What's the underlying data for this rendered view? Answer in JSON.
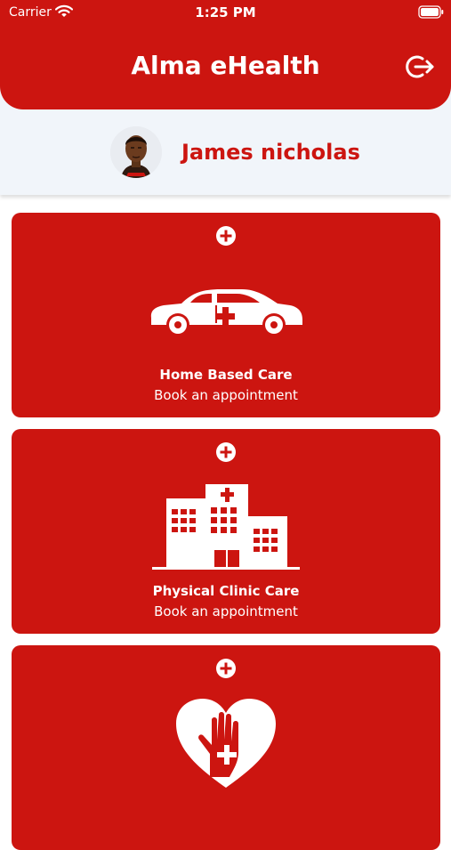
{
  "status_bar": {
    "carrier": "Carrier",
    "time": "1:25 PM"
  },
  "header": {
    "title": "Alma eHealth",
    "logout_icon": "logout-icon"
  },
  "profile": {
    "name": "James nicholas",
    "avatar": "avatar"
  },
  "services": [
    {
      "title": "Home Based Care",
      "subtitle": "Book an appointment",
      "icon": "ambulance-car-icon"
    },
    {
      "title": "Physical Clinic Care",
      "subtitle": "Book an appointment",
      "icon": "hospital-building-icon"
    },
    {
      "title": "",
      "subtitle": "",
      "icon": "heart-hand-icon"
    }
  ],
  "colors": {
    "primary": "#cc1510",
    "profile_bg": "#f1f5fa",
    "white": "#ffffff"
  }
}
